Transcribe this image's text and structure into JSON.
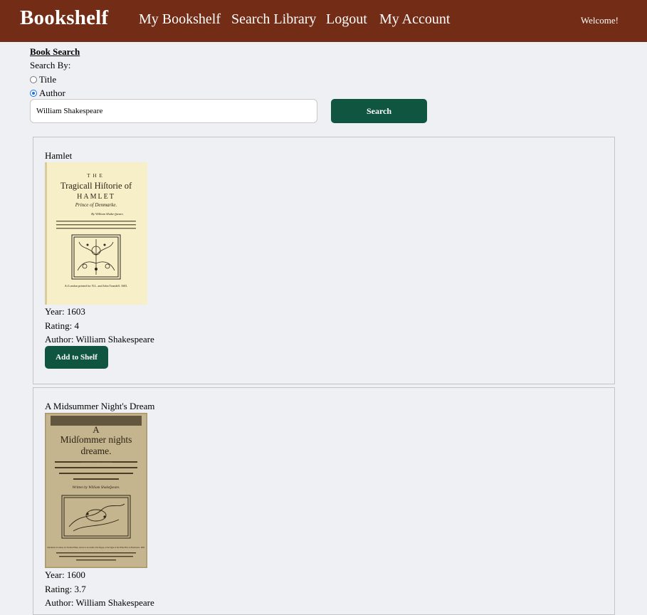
{
  "nav": {
    "brand": "Bookshelf",
    "links": [
      "My Bookshelf",
      "Search Library",
      "Logout",
      "My Account"
    ],
    "welcome": "Welcome!"
  },
  "search": {
    "heading": "Book Search",
    "search_by": "Search By:",
    "options": [
      {
        "label": "Title",
        "checked": false
      },
      {
        "label": "Author",
        "checked": true
      }
    ],
    "query": "William Shakespeare",
    "button": "Search"
  },
  "books": [
    {
      "title": "Hamlet",
      "year": "Year: 1603",
      "rating": "Rating: 4",
      "author": "Author: William Shakespeare",
      "button": "Add to Shelf",
      "cover": {
        "line1": "THE",
        "line2": "Tragicall Hiſtorie of",
        "line3": "HAMLET",
        "line4": "Prince of Denmarke.",
        "line5": "By William Shake-ſpeare.",
        "imprint": "At London printed for N.L. and John Trundell. 1603."
      }
    },
    {
      "title": "A Midsummer Night's Dream",
      "year": "Year: 1600",
      "rating": "Rating: 3.7",
      "author": "Author: William Shakespeare",
      "cover": {
        "line1": "A",
        "line2": "Midſommer nights",
        "line3": "dreame.",
        "line4": "As it hath beene ſundry times pub-likely acted, by the Right honoura-ble, the Lord Chamberlaine his ſeruants.",
        "line5": "Written by William Shakeſpeare.",
        "imprint": "Imprinted at London, for Thomas Fiſher, and are to be ſoulde at his ſhoppe, at the Signe of the White Hart, in Fleetſtreete. 1600."
      }
    }
  ]
}
